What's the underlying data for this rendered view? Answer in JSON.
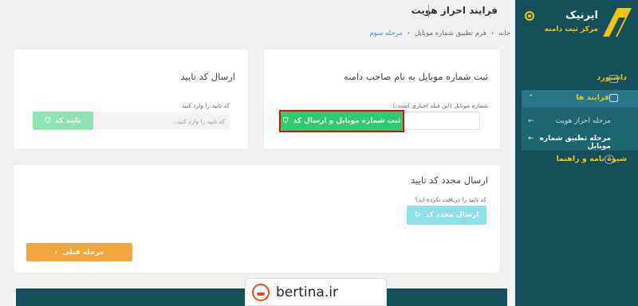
{
  "sidebar": {
    "brand_name": "ایرنیک",
    "brand_sub": "مرکز ثبت دامنه",
    "items": [
      {
        "label": "داشبورد",
        "icon": "monitor-icon"
      },
      {
        "label": "فرایند ها",
        "icon": "document-icon"
      },
      {
        "label": "شیوه نامه و راهنما",
        "icon": "help-icon"
      }
    ],
    "submenu": [
      {
        "label": "مرحله احراز هویت"
      },
      {
        "label": "مرحله تطبیق شماره موبایل"
      }
    ],
    "colors": {
      "bg": "#15505a",
      "accent": "#f1c40f"
    }
  },
  "header": {
    "title": "فرایند احراز هویت",
    "breadcrumb": [
      "خانه",
      "فرم تطبیق شماره موبایل",
      "مرحله سوم"
    ]
  },
  "card_mobile": {
    "title": "ثبت شماره موبایل به نام صاحب دامنه",
    "label": "شماره موبایل (این فیلد اجباری است.)",
    "button": "ثبت شماره موبایل و ارسال کد"
  },
  "card_code": {
    "title": "ارسال کد تایید",
    "label": "کد تایید را وارد کنید",
    "placeholder": "کد تایید را وارد کنید..",
    "button": "تایید کد"
  },
  "card_resend": {
    "title": "ارسال مجدد کد تایید",
    "label": "کد تایید را دریافت نکرده اید؟",
    "button": "ارسال مجدد کد",
    "prev_button": "مرحله قبلی"
  },
  "watermark": {
    "text": "bertina.ir"
  }
}
